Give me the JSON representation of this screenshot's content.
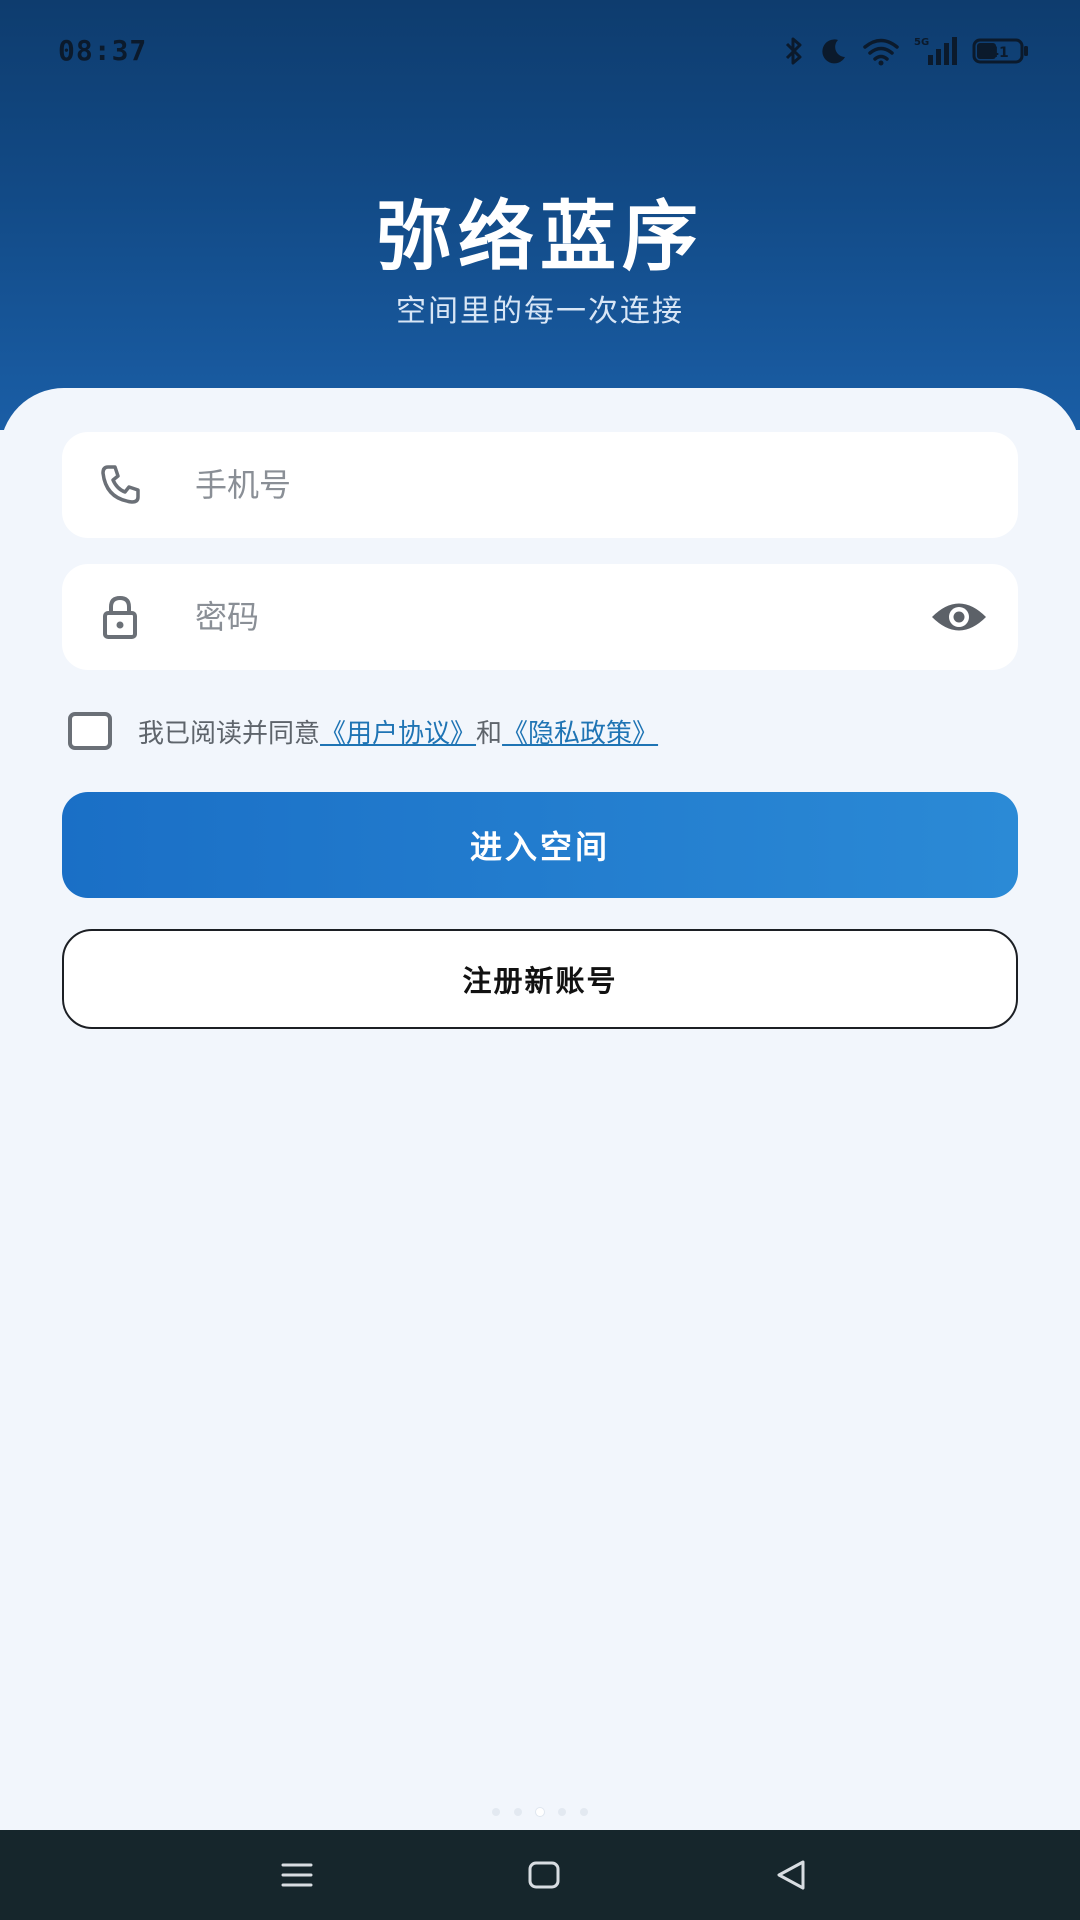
{
  "status_bar": {
    "time": "08:37",
    "network_label": "5G",
    "battery_level": "41",
    "icons": [
      "bluetooth-icon",
      "moon-icon",
      "wifi-icon",
      "signal-icon",
      "battery-icon"
    ]
  },
  "header": {
    "title": "弥络蓝序",
    "subtitle": "空间里的每一次连接"
  },
  "form": {
    "phone_placeholder": "手机号",
    "phone_icon": "phone-icon",
    "password_placeholder": "密码",
    "password_icon": "lock-icon",
    "toggle_visibility_icon": "eye-icon"
  },
  "agreement": {
    "checked": false,
    "prefix": "我已阅读并同意",
    "user_agreement": "《用户协议》",
    "conjunction": "和",
    "privacy_policy": "《隐私政策》"
  },
  "buttons": {
    "login": "进入空间",
    "register": "注册新账号"
  },
  "page_indicator": {
    "count": 5,
    "active": 3
  },
  "navigation": {
    "menu_icon": "menu-icon",
    "home_icon": "home-icon",
    "back_icon": "back-icon"
  },
  "colors": {
    "header_top": "#0e3c6e",
    "header_bottom": "#1a5ea6",
    "primary_button": "#1a6fc6",
    "link": "#1f74b4",
    "background": "#f2f6fc",
    "nav_bar": "#16262c"
  }
}
